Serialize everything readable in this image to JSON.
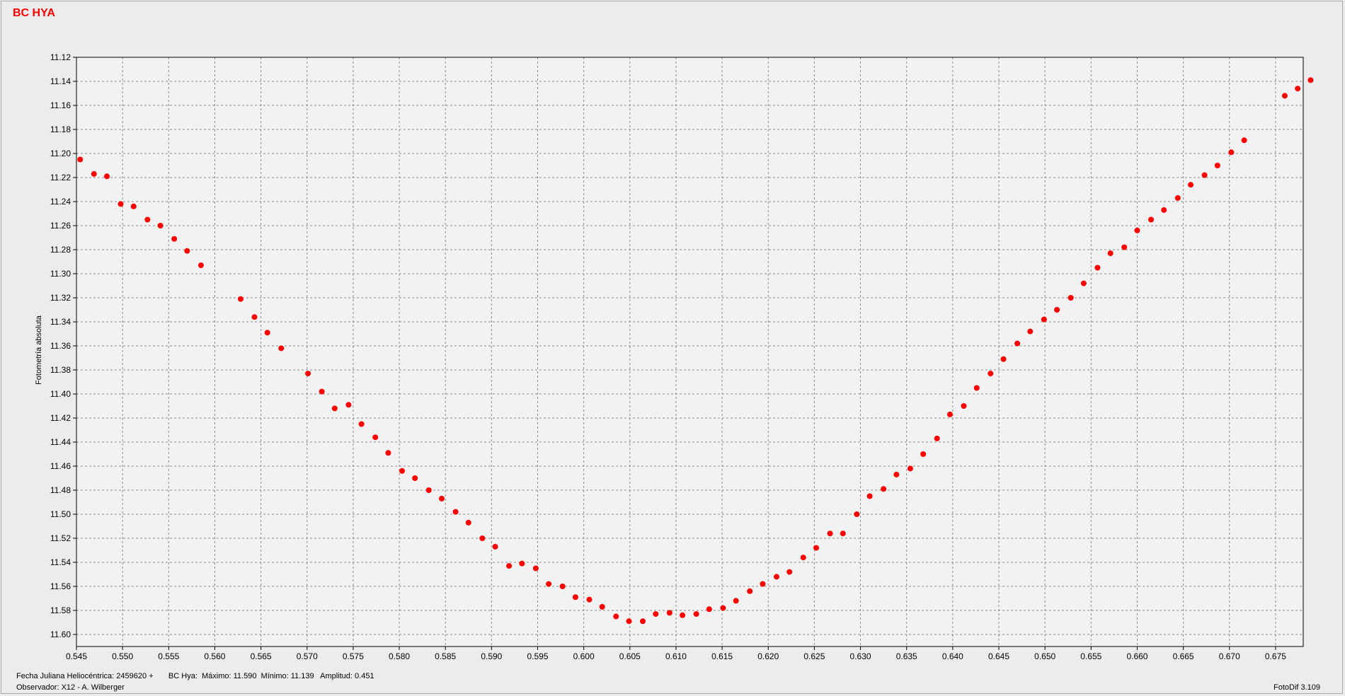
{
  "footer": {
    "line1": "Fecha Juliana Heliocéntrica: 2459620 +       BC Hya:  Máximo: 11.590  Mínimo: 11.139   Amplitud: 0.451",
    "line2": "Observador: X12 - A. Wilberger",
    "version": "FotoDif 3.109"
  },
  "chart_data": {
    "type": "scatter",
    "title": "BC HYA",
    "xlabel": "",
    "ylabel": "Fotometría absoluta",
    "xlim": [
      0.545,
      0.678
    ],
    "ylim": [
      11.12,
      11.61
    ],
    "y_inverted": true,
    "grid": true,
    "marker_color": "#ff0000",
    "x_ticks": [
      "0.545",
      "0.550",
      "0.555",
      "0.560",
      "0.565",
      "0.570",
      "0.575",
      "0.580",
      "0.585",
      "0.590",
      "0.595",
      "0.600",
      "0.605",
      "0.610",
      "0.615",
      "0.620",
      "0.625",
      "0.630",
      "0.635",
      "0.640",
      "0.645",
      "0.650",
      "0.655",
      "0.660",
      "0.665",
      "0.670",
      "0.675"
    ],
    "y_ticks": [
      "11.12",
      "11.14",
      "11.16",
      "11.18",
      "11.20",
      "11.22",
      "11.24",
      "11.26",
      "11.28",
      "11.30",
      "11.32",
      "11.34",
      "11.36",
      "11.38",
      "11.40",
      "11.42",
      "11.44",
      "11.46",
      "11.48",
      "11.50",
      "11.52",
      "11.54",
      "11.56",
      "11.58",
      "11.60"
    ],
    "x": [
      0.5454,
      0.5469,
      0.5483,
      0.5498,
      0.5512,
      0.5527,
      0.5541,
      0.5556,
      0.557,
      0.5585,
      0.5628,
      0.5643,
      0.5657,
      0.5672,
      0.5701,
      0.5716,
      0.573,
      0.5745,
      0.5759,
      0.5774,
      0.5788,
      0.5803,
      0.5817,
      0.5832,
      0.5846,
      0.5861,
      0.5875,
      0.589,
      0.5904,
      0.5919,
      0.5933,
      0.5948,
      0.5962,
      0.5977,
      0.5991,
      0.6006,
      0.602,
      0.6035,
      0.6049,
      0.6064,
      0.6078,
      0.6093,
      0.6107,
      0.6122,
      0.6136,
      0.6151,
      0.6165,
      0.618,
      0.6194,
      0.6209,
      0.6223,
      0.6238,
      0.6252,
      0.6267,
      0.6281,
      0.6296,
      0.631,
      0.6325,
      0.6339,
      0.6354,
      0.6368,
      0.6383,
      0.6397,
      0.6412,
      0.6426,
      0.6441,
      0.6455,
      0.647,
      0.6484,
      0.6499,
      0.6513,
      0.6528,
      0.6542,
      0.6557,
      0.6571,
      0.6586,
      0.66,
      0.6615,
      0.6629,
      0.6644,
      0.6658,
      0.6673,
      0.6687,
      0.6702,
      0.6716,
      0.676,
      0.6774,
      0.6788
    ],
    "y": [
      11.205,
      11.217,
      11.219,
      11.242,
      11.244,
      11.255,
      11.26,
      11.271,
      11.281,
      11.293,
      11.321,
      11.336,
      11.349,
      11.362,
      11.383,
      11.398,
      11.412,
      11.409,
      11.425,
      11.436,
      11.449,
      11.464,
      11.47,
      11.48,
      11.487,
      11.498,
      11.507,
      11.52,
      11.527,
      11.543,
      11.541,
      11.545,
      11.558,
      11.56,
      11.569,
      11.571,
      11.577,
      11.585,
      11.589,
      11.589,
      11.583,
      11.582,
      11.584,
      11.583,
      11.579,
      11.578,
      11.572,
      11.564,
      11.558,
      11.552,
      11.548,
      11.536,
      11.528,
      11.516,
      11.516,
      11.5,
      11.485,
      11.479,
      11.467,
      11.462,
      11.45,
      11.437,
      11.417,
      11.41,
      11.395,
      11.383,
      11.371,
      11.358,
      11.348,
      11.338,
      11.33,
      11.32,
      11.308,
      11.295,
      11.283,
      11.278,
      11.264,
      11.255,
      11.247,
      11.237,
      11.226,
      11.218,
      11.21,
      11.199,
      11.189,
      11.152,
      11.146,
      11.139
    ]
  }
}
